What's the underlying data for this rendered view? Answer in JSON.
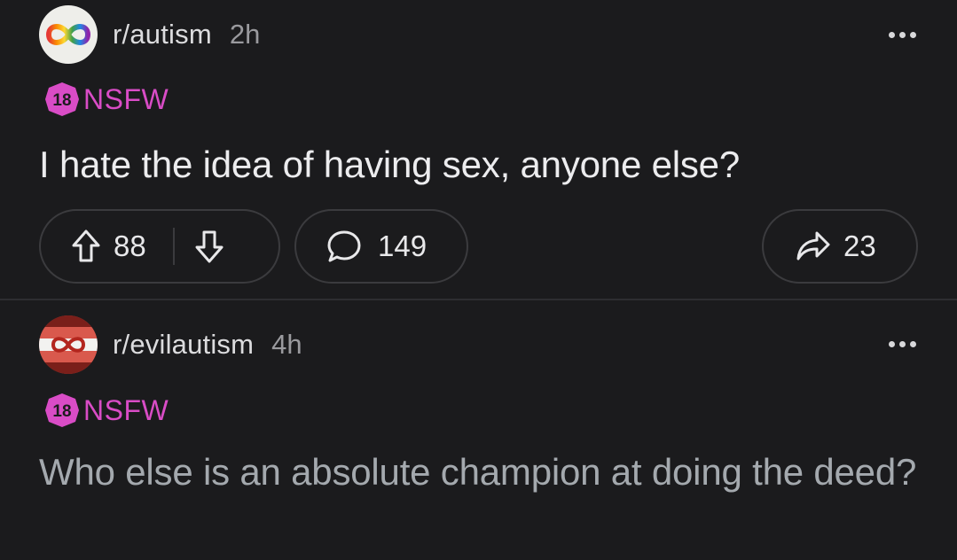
{
  "posts": [
    {
      "subreddit": "r/autism",
      "time": "2h",
      "nsfw_badge": "18",
      "nsfw_label": "NSFW",
      "title": "I hate the idea of having sex, anyone else?",
      "upvotes": "88",
      "comments": "149",
      "shares": "23",
      "avatar_icon": "rainbow-infinity-icon"
    },
    {
      "subreddit": "r/evilautism",
      "time": "4h",
      "nsfw_badge": "18",
      "nsfw_label": "NSFW",
      "title": "Who else is an absolute champion at doing the deed?",
      "avatar_icon": "infinity-striped-flag-icon"
    }
  ],
  "colors": {
    "background": "#1b1b1d",
    "nsfw": "#d94cc6",
    "text": "#ececee",
    "muted": "#9a9a9e"
  }
}
